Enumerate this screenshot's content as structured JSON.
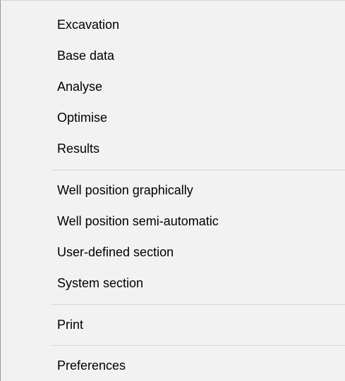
{
  "context_menu": {
    "groups": [
      {
        "items": [
          {
            "label": "Excavation"
          },
          {
            "label": "Base data"
          },
          {
            "label": "Analyse"
          },
          {
            "label": "Optimise"
          },
          {
            "label": "Results"
          }
        ]
      },
      {
        "items": [
          {
            "label": "Well position graphically"
          },
          {
            "label": "Well position semi-automatic"
          },
          {
            "label": "User-defined section"
          },
          {
            "label": "System section"
          }
        ]
      },
      {
        "items": [
          {
            "label": "Print"
          }
        ]
      },
      {
        "items": [
          {
            "label": "Preferences"
          }
        ]
      }
    ]
  }
}
